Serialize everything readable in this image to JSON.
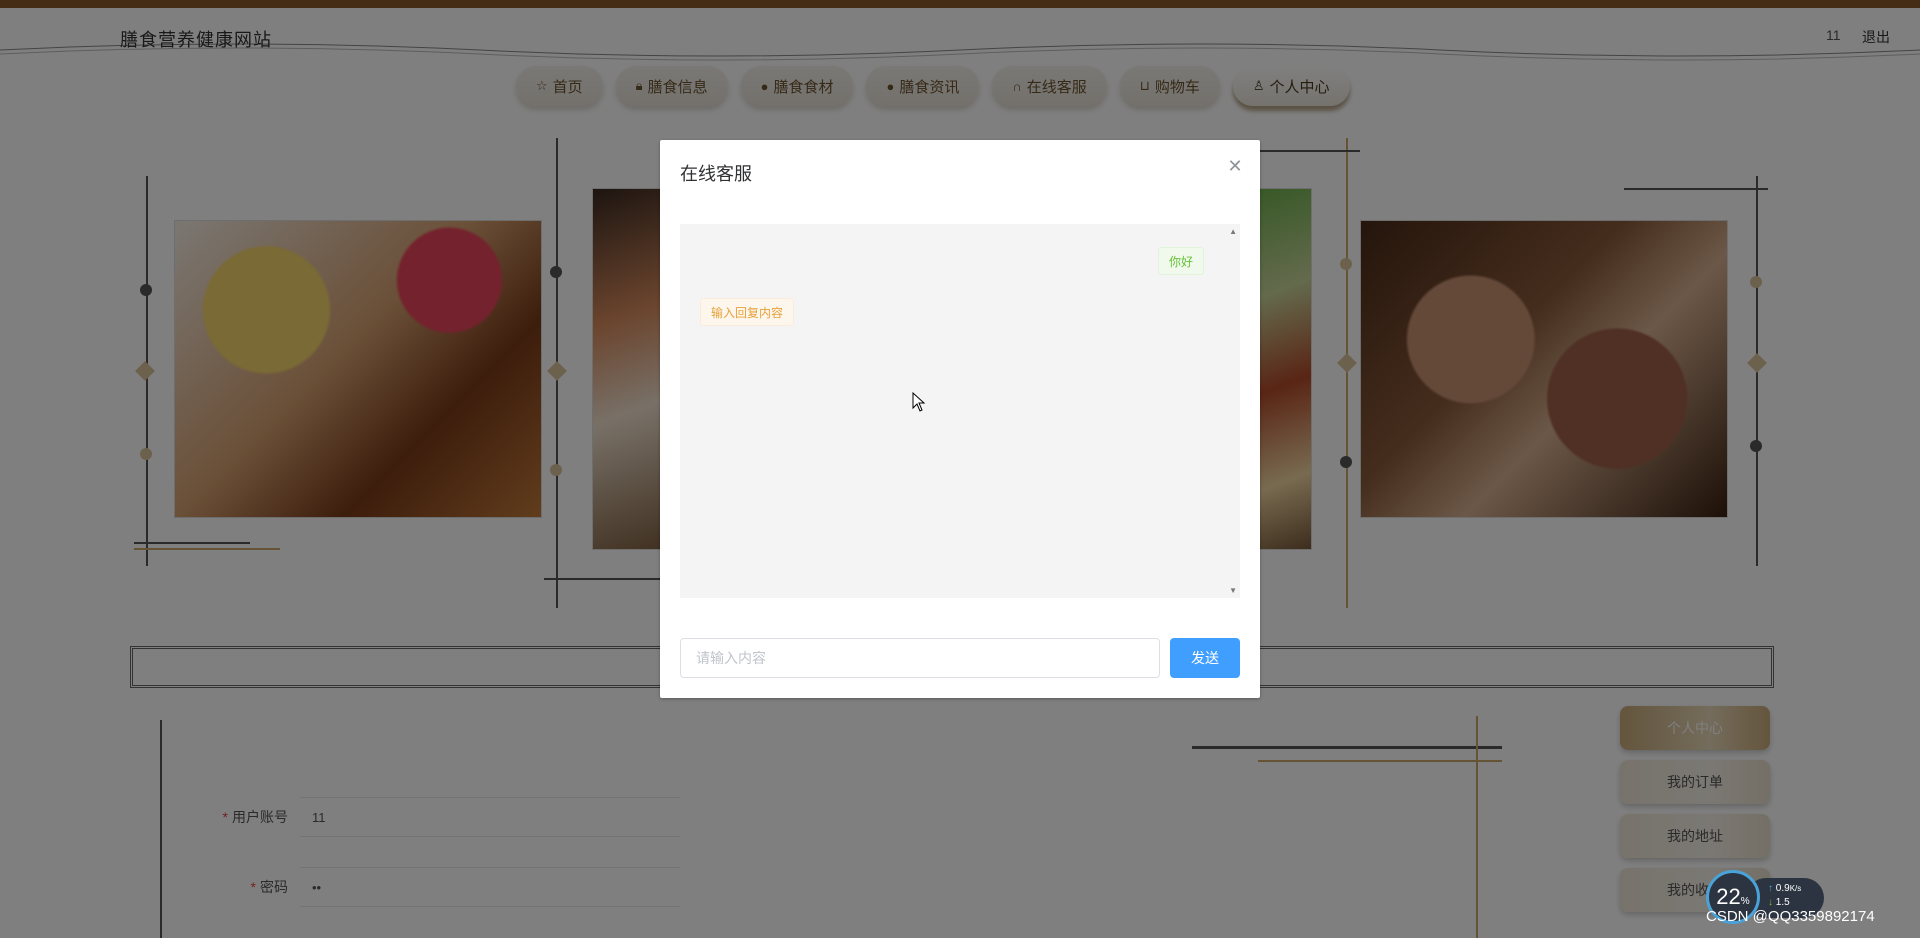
{
  "header": {
    "site_title": "膳食营养健康网站",
    "user_name": "11",
    "logout_label": "退出"
  },
  "nav": {
    "items": [
      {
        "label": "首页",
        "icon": "star-icon"
      },
      {
        "label": "膳食信息",
        "icon": "bag-icon"
      },
      {
        "label": "膳食食材",
        "icon": "info-icon"
      },
      {
        "label": "膳食资讯",
        "icon": "question-icon"
      },
      {
        "label": "在线客服",
        "icon": "headset-icon"
      },
      {
        "label": "购物车",
        "icon": "cart-icon"
      },
      {
        "label": "个人中心",
        "icon": "user-icon",
        "active": true
      }
    ]
  },
  "form": {
    "account_label": "用户账号",
    "account_value": "11",
    "password_label": "密码",
    "password_value": "••"
  },
  "side_menu": {
    "items": [
      {
        "label": "个人中心",
        "active": true
      },
      {
        "label": "我的订单"
      },
      {
        "label": "我的地址"
      },
      {
        "label": "我的收藏"
      }
    ]
  },
  "modal": {
    "title": "在线客服",
    "messages": [
      {
        "side": "right",
        "text": "你好"
      },
      {
        "side": "left",
        "text": "输入回复内容"
      }
    ],
    "input_placeholder": "请输入内容",
    "send_label": "发送"
  },
  "net_widget": {
    "cpu_percent": "22",
    "cpu_unit": "%",
    "up_speed": "0.9",
    "up_unit": "K/s",
    "down_speed": "1.5"
  },
  "watermark": "CSDN @QQ3359892174",
  "colors": {
    "primary_button": "#409eff",
    "topbar": "#8b5a2b",
    "reply_bubble_text": "#e6a23c",
    "user_bubble_text": "#67c23a"
  }
}
